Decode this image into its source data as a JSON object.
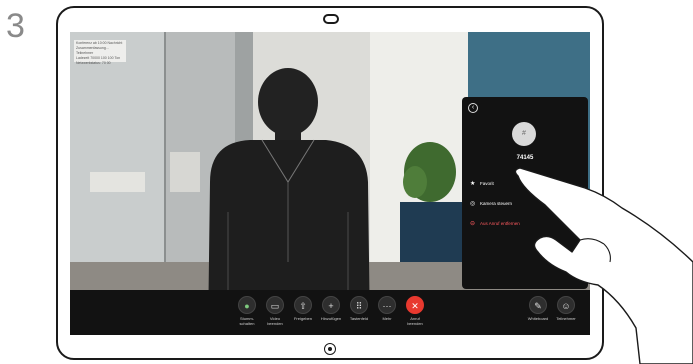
{
  "step": {
    "number": "3"
  },
  "self_view": {
    "lines": [
      "Konferenz ab 10:00 Nachricht",
      "Zusammenfassung... Teilnehmer",
      "Ladezeit 70000 100 100 Ton",
      "Netzwerkstatus: 70 00"
    ]
  },
  "call_panel": {
    "back_icon": "chevron-left-icon",
    "avatar_initial": "#",
    "contact_number": "74145",
    "menu": [
      {
        "label": "Favorit",
        "icon": "star-icon",
        "color": "#ffffff"
      },
      {
        "label": "Kamera steuern",
        "icon": "camera-control-icon",
        "color": "#ffffff"
      },
      {
        "label": "Aus Anruf entfernen",
        "icon": "remove-icon",
        "color": "#ff5a5f"
      }
    ]
  },
  "toolbar": {
    "buttons": [
      {
        "label": "Stumm-\nschalten",
        "icon": "microphone-icon"
      },
      {
        "label": "Video\nbeenden",
        "icon": "video-icon"
      },
      {
        "label": "Freigeben",
        "icon": "share-icon"
      },
      {
        "label": "Hinzufügen",
        "icon": "plus-icon"
      },
      {
        "label": "Tastenfeld",
        "icon": "keypad-icon"
      },
      {
        "label": "Mehr",
        "icon": "more-icon"
      },
      {
        "label": "Anruf\nbeenden",
        "icon": "end-call-icon"
      },
      {
        "label": "Whiteboard",
        "icon": "whiteboard-icon"
      },
      {
        "label": "Teilnehmer",
        "icon": "participants-icon"
      }
    ]
  },
  "colors": {
    "end_call": "#e8392f",
    "danger": "#ff5a5f",
    "mute_icon": "#7ec97e"
  }
}
